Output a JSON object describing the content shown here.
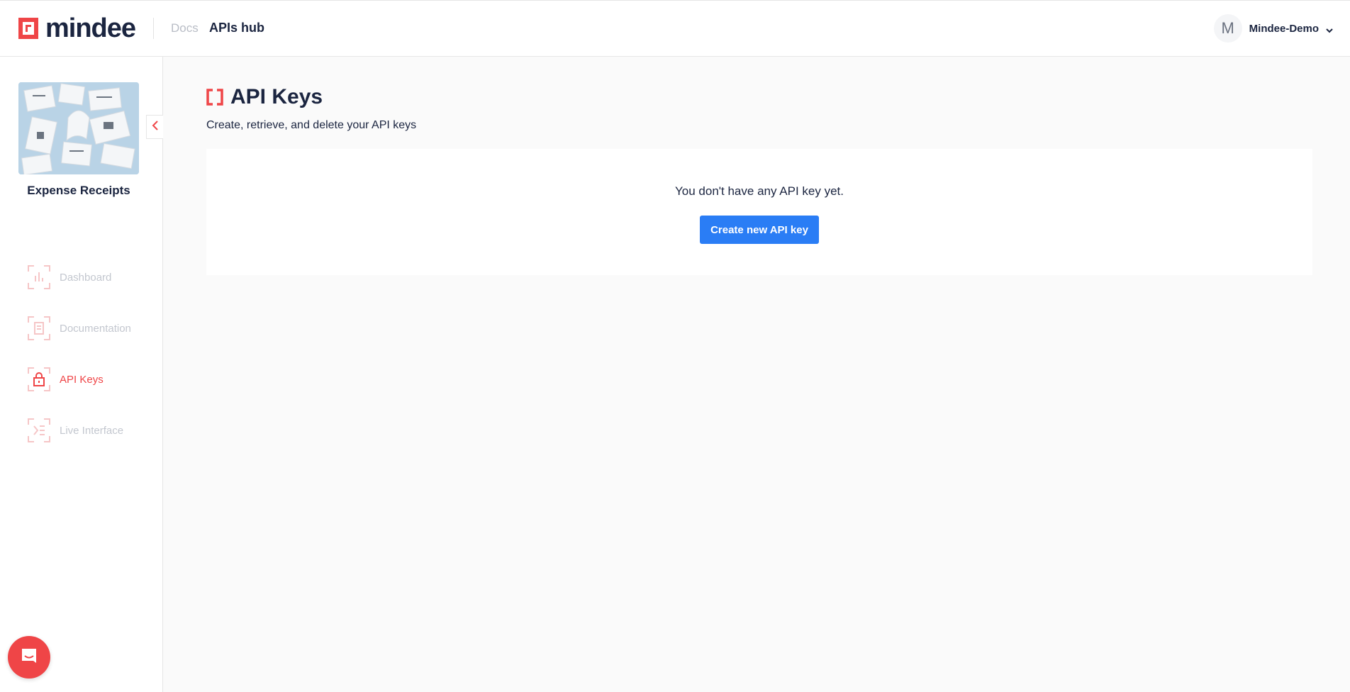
{
  "header": {
    "brand": "mindee",
    "nav": [
      {
        "label": "Docs"
      },
      {
        "label": "APIs hub"
      }
    ],
    "user": {
      "avatar_initial": "M",
      "name": "Mindee-Demo"
    }
  },
  "sidebar": {
    "product_name": "Expense Receipts",
    "items": [
      {
        "label": "Dashboard",
        "icon": "dashboard-icon",
        "active": false
      },
      {
        "label": "Documentation",
        "icon": "documentation-icon",
        "active": false
      },
      {
        "label": "API Keys",
        "icon": "lock-icon",
        "active": true
      },
      {
        "label": "Live Interface",
        "icon": "live-interface-icon",
        "active": false
      }
    ]
  },
  "main": {
    "title": "API Keys",
    "subtitle": "Create, retrieve, and delete your API keys",
    "empty_message": "You don't have any API key yet.",
    "create_button": "Create new API key"
  },
  "colors": {
    "brand_red": "#ef4547",
    "primary_blue": "#2a7df5",
    "text_dark": "#1b2540",
    "muted": "#c3c7cf"
  }
}
